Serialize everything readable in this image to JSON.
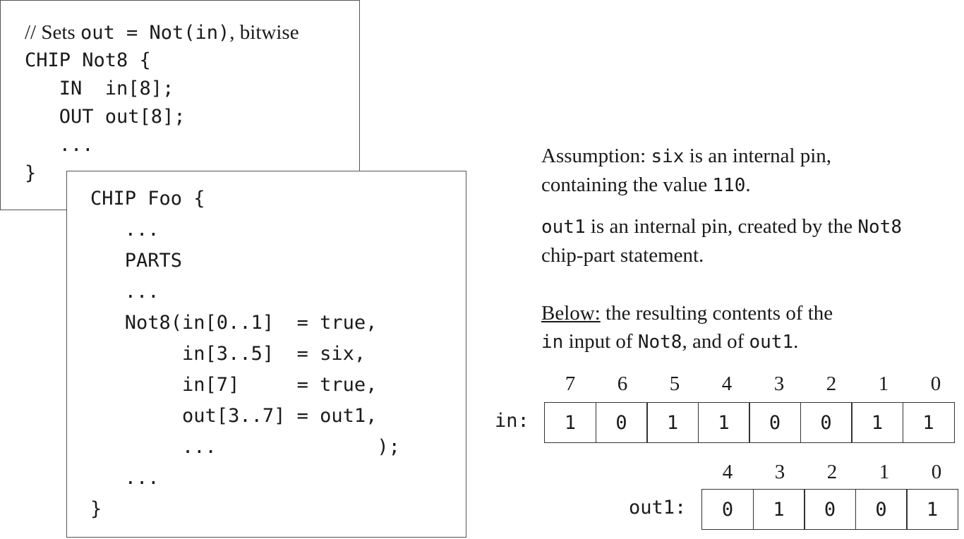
{
  "not8_box": {
    "comment_prefix": "// Sets ",
    "comment_code": "out = Not(in)",
    "comment_suffix": ", bitwise",
    "lines": [
      "CHIP Not8 {",
      "   IN  in[8];",
      "   OUT out[8];",
      "   ...",
      "}"
    ]
  },
  "foo_box": {
    "lines": [
      "CHIP Foo {",
      "   ...",
      "   PARTS",
      "   ...",
      "   Not8(in[0..1]  = true,",
      "        in[3..5]  = six,",
      "        in[7]     = true,",
      "        out[3..7] = out1,",
      "        ...              );",
      "   ...",
      "}"
    ]
  },
  "notes": {
    "n1_a": "Assumption: ",
    "n1_b": "six",
    "n1_c": " is an internal pin,",
    "n1_d": "containing the value ",
    "n1_e": "110",
    "n1_f": ".",
    "n2_a": "out1",
    "n2_b": " is an internal pin, created by the ",
    "n2_c": "Not8",
    "n2_d": "chip-part statement.",
    "n3_a": "Below:",
    "n3_b": " the resulting contents of the",
    "n3_c": "in",
    "n3_d": " input of ",
    "n3_e": "Not8",
    "n3_f": ", and of ",
    "n3_g": "out1",
    "n3_h": "."
  },
  "in_register": {
    "label": "in:",
    "indices": [
      "7",
      "6",
      "5",
      "4",
      "3",
      "2",
      "1",
      "0"
    ],
    "bits": [
      "1",
      "0",
      "1",
      "1",
      "0",
      "0",
      "1",
      "1"
    ]
  },
  "out1_register": {
    "label": "out1:",
    "indices": [
      "4",
      "3",
      "2",
      "1",
      "0"
    ],
    "bits": [
      "0",
      "1",
      "0",
      "0",
      "1"
    ]
  }
}
